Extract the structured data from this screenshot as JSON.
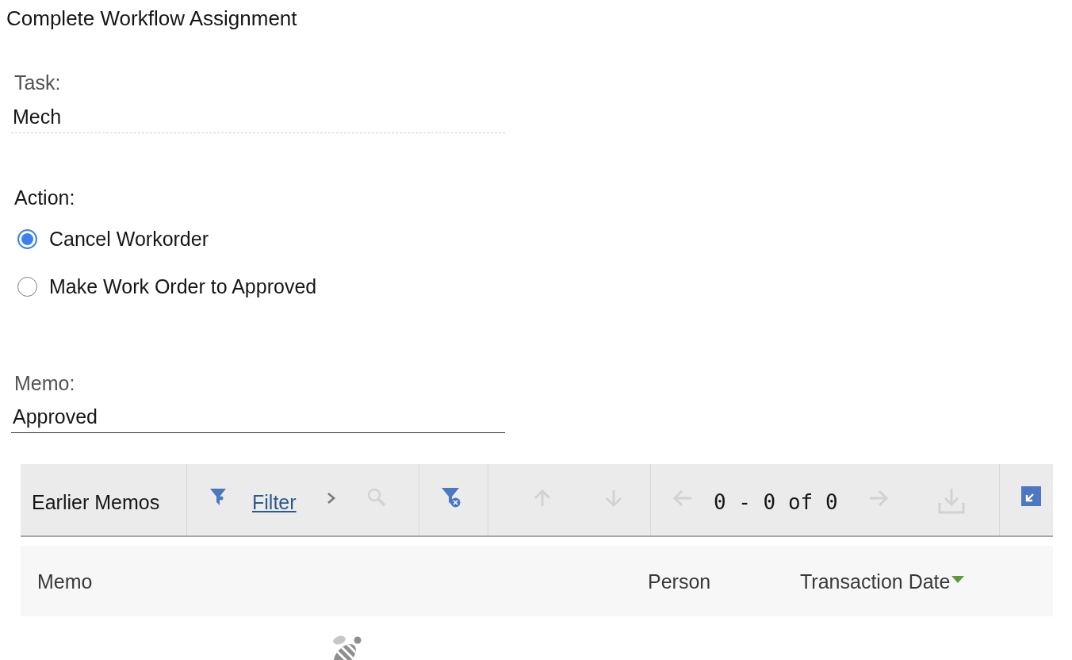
{
  "page_title": "Complete Workflow Assignment",
  "task": {
    "label": "Task:",
    "value": "Mech"
  },
  "action": {
    "label": "Action:",
    "options": [
      {
        "label": "Cancel Workorder",
        "selected": true
      },
      {
        "label": "Make Work Order to Approved",
        "selected": false
      }
    ]
  },
  "memo": {
    "label": "Memo:",
    "value": "Approved"
  },
  "table": {
    "title": "Earlier Memos",
    "filter_link": "Filter",
    "pagination": "0 - 0 of 0",
    "tools": [
      {
        "kind": "filter",
        "disabled": false
      },
      {
        "kind": "expand",
        "disabled": false
      },
      {
        "kind": "search",
        "disabled": true
      },
      {
        "kind": "clear-filter",
        "disabled": false
      },
      {
        "kind": "up",
        "disabled": true
      },
      {
        "kind": "down",
        "disabled": true
      },
      {
        "kind": "previous",
        "disabled": true
      },
      {
        "kind": "next",
        "disabled": true
      },
      {
        "kind": "download",
        "disabled": true
      },
      {
        "kind": "collapse",
        "disabled": false
      }
    ],
    "columns": [
      {
        "label": "Memo",
        "sorted": false
      },
      {
        "label": "Person",
        "sorted": false
      },
      {
        "label": "Transaction Date",
        "sorted": true
      }
    ]
  }
}
